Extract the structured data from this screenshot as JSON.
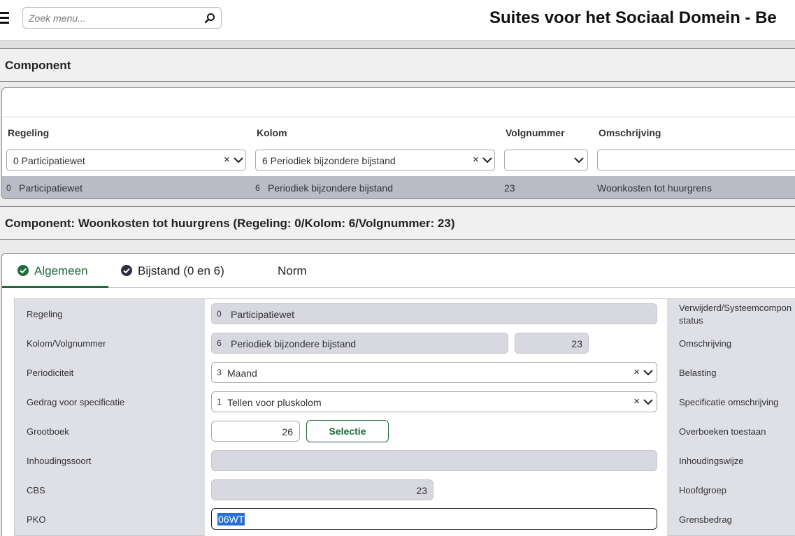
{
  "header": {
    "search_placeholder": "Zoek menu...",
    "app_title": "Suites voor het Sociaal Domein - Be"
  },
  "component_section": {
    "title": "Component"
  },
  "grid": {
    "columns": [
      "Regeling",
      "Kolom",
      "Volgnummer",
      "Omschrijving"
    ],
    "filters": {
      "regeling": "0 Participatiewet",
      "kolom": "6 Periodiek bijzondere bijstand",
      "volgnummer": "",
      "omschrijving": ""
    },
    "row": {
      "regeling_code": "0",
      "regeling_name": "Participatiewet",
      "kolom_code": "6",
      "kolom_name": "Periodiek bijzondere bijstand",
      "volgnummer": "23",
      "omschrijving": "Woonkosten tot huurgrens"
    }
  },
  "detail_section": {
    "title": "Component: Woonkosten tot huurgrens (Regeling: 0/Kolom: 6/Volgnummer: 23)"
  },
  "tabs": [
    {
      "label": "Algemeen",
      "active": true,
      "icon": "check-circle-icon"
    },
    {
      "label": "Bijstand (0 en 6)",
      "active": false,
      "icon": "check-circle-icon"
    },
    {
      "label": "Norm",
      "active": false
    }
  ],
  "form": {
    "left_labels": [
      "Regeling",
      "Kolom/Volgnummer",
      "Periodiciteit",
      "Gedrag voor specificatie",
      "Grootboek",
      "Inhoudingssoort",
      "CBS",
      "PKO"
    ],
    "regeling": {
      "code": "0",
      "name": "Participatiewet"
    },
    "kolom": {
      "code": "6",
      "name": "Periodiek bijzondere bijstand"
    },
    "volgnummer": "23",
    "periodiciteit": {
      "code": "3",
      "name": "Maand"
    },
    "gedrag": {
      "code": "1",
      "name": "Tellen voor pluskolom"
    },
    "grootboek": "26",
    "selectie_button": "Selectie",
    "inhoudingssoort": "",
    "cbs": "23",
    "pko": "06WT",
    "right_labels": [
      "Verwijderd/Systeemcompon",
      "status",
      "Omschrijving",
      "Belasting",
      "Specificatie omschrijving",
      "Overboeken toestaan",
      "Inhoudingswijze",
      "Hoofdgroep",
      "Grensbedrag"
    ]
  },
  "colors": {
    "accent_green": "#1f6b3a",
    "row_selected": "#b9bcc6",
    "selection_blue": "#2a6fd6"
  }
}
